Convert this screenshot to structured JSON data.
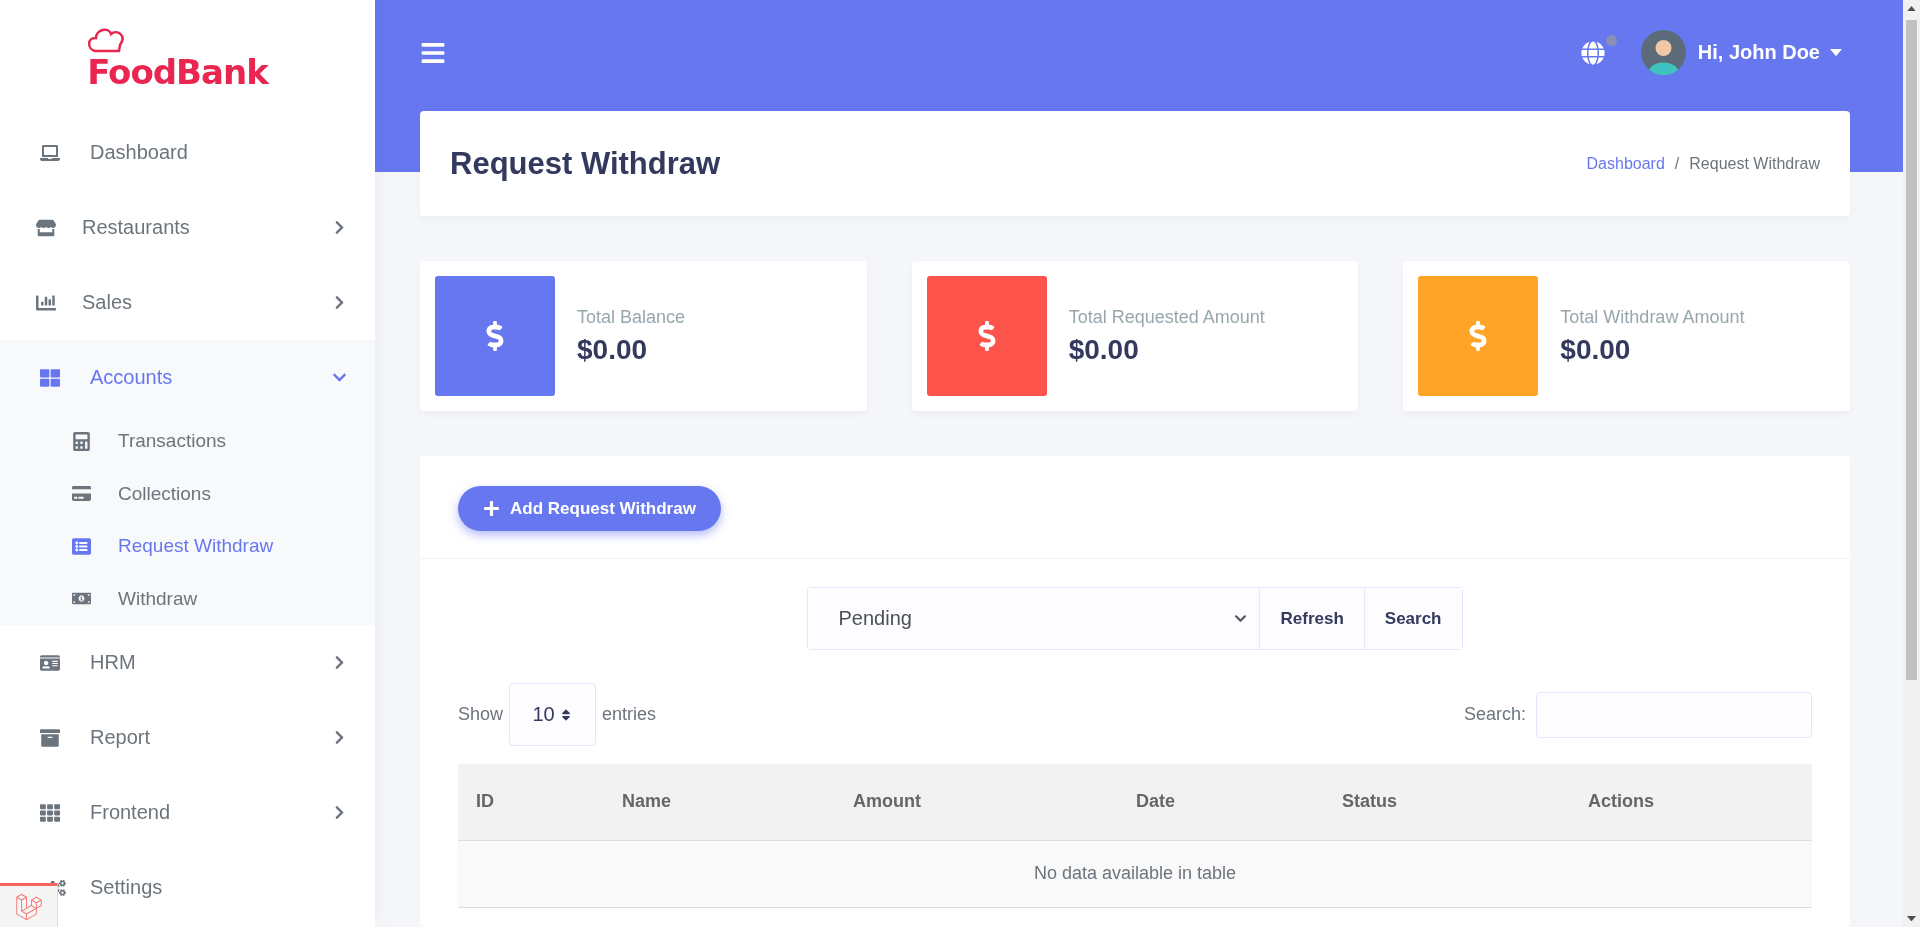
{
  "sidebar": {
    "logo": "FoodBank",
    "items": [
      {
        "label": "Dashboard",
        "selected": false
      },
      {
        "label": "Restaurants",
        "selected": false,
        "expanded": false
      },
      {
        "label": "Sales",
        "selected": false,
        "expanded": false
      },
      {
        "label": "Accounts",
        "selected": true,
        "expanded": true,
        "children": [
          {
            "label": "Transactions",
            "selected": false
          },
          {
            "label": "Collections",
            "selected": false
          },
          {
            "label": "Request Withdraw",
            "selected": true
          },
          {
            "label": "Withdraw",
            "selected": false
          }
        ]
      },
      {
        "label": "HRM",
        "selected": false,
        "expanded": false
      },
      {
        "label": "Report",
        "selected": false,
        "expanded": false
      },
      {
        "label": "Frontend",
        "selected": false,
        "expanded": false
      },
      {
        "label": "Settings",
        "selected": false
      }
    ]
  },
  "navbar": {
    "language_notification": true,
    "user_name": "Hi, John Doe"
  },
  "page_header": {
    "title": "Request Withdraw",
    "breadcrumb": [
      "Dashboard",
      "Request Withdraw"
    ],
    "breadcrumb_separator": "/"
  },
  "stats": [
    {
      "label": "Total Balance",
      "value": "$0.00",
      "color": "#6777ef"
    },
    {
      "label": "Total Requested Amount",
      "value": "$0.00",
      "color": "#fc544b"
    },
    {
      "label": "Total Withdraw Amount",
      "value": "$0.00",
      "color": "#ffa426"
    }
  ],
  "add_button": "Add Request Withdraw",
  "filter": {
    "status": "Pending",
    "buttons": [
      "Refresh",
      "Search"
    ]
  },
  "table_controls": {
    "show_label": "Show",
    "page_length": "10",
    "entries_label": "entries",
    "search_label": "Search:"
  },
  "table": {
    "columns": [
      "ID",
      "Name",
      "Amount",
      "Date",
      "Status",
      "Actions"
    ],
    "empty_message": "No data available in table"
  }
}
